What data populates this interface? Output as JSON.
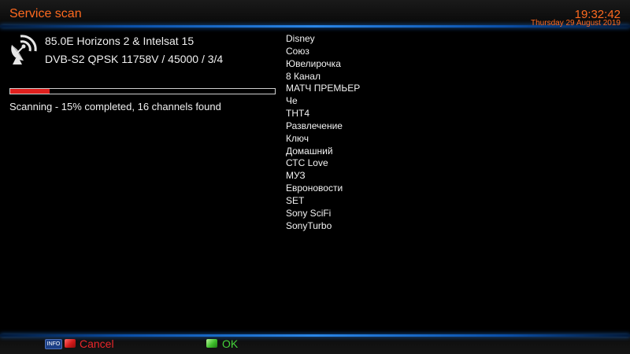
{
  "header": {
    "title": "Service scan",
    "time": "19:32:42",
    "date": "Thursday 29 August 2019"
  },
  "scan": {
    "satellite": "85.0E Horizons 2 & Intelsat 15",
    "transponder": "DVB-S2 QPSK 11758V / 45000 / 3/4",
    "progress_percent": 15,
    "status": "Scanning - 15% completed, 16 channels found"
  },
  "channels": [
    "Disney",
    "Союз",
    "Ювелирочка",
    "8 Канал",
    "МАТЧ ПРЕМЬЕР",
    "Че",
    "ТНТ4",
    "Развлечение",
    "Ключ",
    "Домашний",
    "СТС Love",
    "МУЗ",
    "Евроновости",
    "SET",
    "Sony SciFi",
    "SonyTurbo"
  ],
  "footer": {
    "info_key": "INFO",
    "cancel_label": "Cancel",
    "ok_label": "OK"
  },
  "icons": {
    "satellite": "satellite-dish-icon",
    "info": "info-key-icon",
    "red": "red-key-icon",
    "green": "green-key-icon"
  },
  "colors": {
    "accent": "#ff6a1f",
    "glow": "#2a86e6",
    "progress": "#e0201e",
    "cancel": "#e8262a",
    "ok": "#45d23a"
  }
}
